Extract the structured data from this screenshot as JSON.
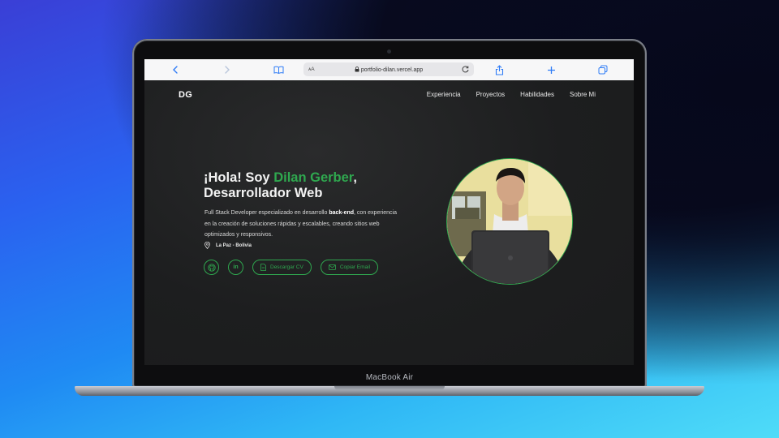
{
  "device": {
    "label": "MacBook Air"
  },
  "browser": {
    "url": "portfolio-dilan.vercel.app",
    "text_size_label": "ᴀA"
  },
  "site": {
    "logo": "DG",
    "nav": [
      "Experiencia",
      "Proyectos",
      "Habilidades",
      "Sobre Mi"
    ],
    "hero": {
      "greeting": "¡Hola! Soy ",
      "name": "Dilan Gerber",
      "comma": ",",
      "role": "Desarrollador Web",
      "desc_part1": "Full Stack Developer especializado en desarrollo ",
      "desc_bold": "back-end",
      "desc_part2": ", con experiencia en la creación de soluciones rápidas y escalables, creando sitios web optimizados y responsivos.",
      "location": "La Paz - Bolivia"
    },
    "actions": {
      "github": "github-icon",
      "linkedin_text": "in",
      "cv_label": "Descargar CV",
      "email_label": "Copiar Email"
    },
    "colors": {
      "accent": "#2fa84f",
      "background": "#1d1e1f"
    }
  }
}
